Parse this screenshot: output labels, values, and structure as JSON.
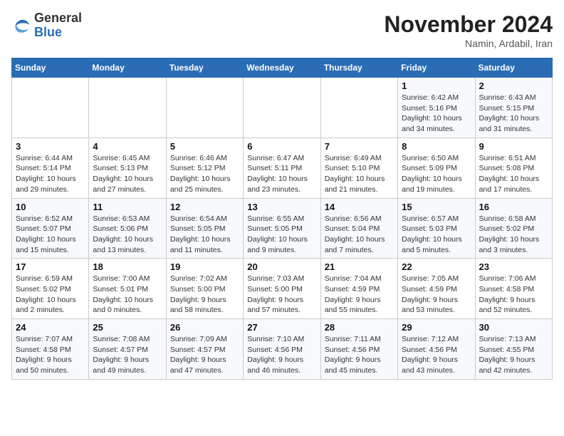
{
  "header": {
    "logo_line1": "General",
    "logo_line2": "Blue",
    "month": "November 2024",
    "location": "Namin, Ardabil, Iran"
  },
  "weekdays": [
    "Sunday",
    "Monday",
    "Tuesday",
    "Wednesday",
    "Thursday",
    "Friday",
    "Saturday"
  ],
  "weeks": [
    [
      {
        "day": "",
        "detail": ""
      },
      {
        "day": "",
        "detail": ""
      },
      {
        "day": "",
        "detail": ""
      },
      {
        "day": "",
        "detail": ""
      },
      {
        "day": "",
        "detail": ""
      },
      {
        "day": "1",
        "detail": "Sunrise: 6:42 AM\nSunset: 5:16 PM\nDaylight: 10 hours\nand 34 minutes."
      },
      {
        "day": "2",
        "detail": "Sunrise: 6:43 AM\nSunset: 5:15 PM\nDaylight: 10 hours\nand 31 minutes."
      }
    ],
    [
      {
        "day": "3",
        "detail": "Sunrise: 6:44 AM\nSunset: 5:14 PM\nDaylight: 10 hours\nand 29 minutes."
      },
      {
        "day": "4",
        "detail": "Sunrise: 6:45 AM\nSunset: 5:13 PM\nDaylight: 10 hours\nand 27 minutes."
      },
      {
        "day": "5",
        "detail": "Sunrise: 6:46 AM\nSunset: 5:12 PM\nDaylight: 10 hours\nand 25 minutes."
      },
      {
        "day": "6",
        "detail": "Sunrise: 6:47 AM\nSunset: 5:11 PM\nDaylight: 10 hours\nand 23 minutes."
      },
      {
        "day": "7",
        "detail": "Sunrise: 6:49 AM\nSunset: 5:10 PM\nDaylight: 10 hours\nand 21 minutes."
      },
      {
        "day": "8",
        "detail": "Sunrise: 6:50 AM\nSunset: 5:09 PM\nDaylight: 10 hours\nand 19 minutes."
      },
      {
        "day": "9",
        "detail": "Sunrise: 6:51 AM\nSunset: 5:08 PM\nDaylight: 10 hours\nand 17 minutes."
      }
    ],
    [
      {
        "day": "10",
        "detail": "Sunrise: 6:52 AM\nSunset: 5:07 PM\nDaylight: 10 hours\nand 15 minutes."
      },
      {
        "day": "11",
        "detail": "Sunrise: 6:53 AM\nSunset: 5:06 PM\nDaylight: 10 hours\nand 13 minutes."
      },
      {
        "day": "12",
        "detail": "Sunrise: 6:54 AM\nSunset: 5:05 PM\nDaylight: 10 hours\nand 11 minutes."
      },
      {
        "day": "13",
        "detail": "Sunrise: 6:55 AM\nSunset: 5:05 PM\nDaylight: 10 hours\nand 9 minutes."
      },
      {
        "day": "14",
        "detail": "Sunrise: 6:56 AM\nSunset: 5:04 PM\nDaylight: 10 hours\nand 7 minutes."
      },
      {
        "day": "15",
        "detail": "Sunrise: 6:57 AM\nSunset: 5:03 PM\nDaylight: 10 hours\nand 5 minutes."
      },
      {
        "day": "16",
        "detail": "Sunrise: 6:58 AM\nSunset: 5:02 PM\nDaylight: 10 hours\nand 3 minutes."
      }
    ],
    [
      {
        "day": "17",
        "detail": "Sunrise: 6:59 AM\nSunset: 5:02 PM\nDaylight: 10 hours\nand 2 minutes."
      },
      {
        "day": "18",
        "detail": "Sunrise: 7:00 AM\nSunset: 5:01 PM\nDaylight: 10 hours\nand 0 minutes."
      },
      {
        "day": "19",
        "detail": "Sunrise: 7:02 AM\nSunset: 5:00 PM\nDaylight: 9 hours\nand 58 minutes."
      },
      {
        "day": "20",
        "detail": "Sunrise: 7:03 AM\nSunset: 5:00 PM\nDaylight: 9 hours\nand 57 minutes."
      },
      {
        "day": "21",
        "detail": "Sunrise: 7:04 AM\nSunset: 4:59 PM\nDaylight: 9 hours\nand 55 minutes."
      },
      {
        "day": "22",
        "detail": "Sunrise: 7:05 AM\nSunset: 4:59 PM\nDaylight: 9 hours\nand 53 minutes."
      },
      {
        "day": "23",
        "detail": "Sunrise: 7:06 AM\nSunset: 4:58 PM\nDaylight: 9 hours\nand 52 minutes."
      }
    ],
    [
      {
        "day": "24",
        "detail": "Sunrise: 7:07 AM\nSunset: 4:58 PM\nDaylight: 9 hours\nand 50 minutes."
      },
      {
        "day": "25",
        "detail": "Sunrise: 7:08 AM\nSunset: 4:57 PM\nDaylight: 9 hours\nand 49 minutes."
      },
      {
        "day": "26",
        "detail": "Sunrise: 7:09 AM\nSunset: 4:57 PM\nDaylight: 9 hours\nand 47 minutes."
      },
      {
        "day": "27",
        "detail": "Sunrise: 7:10 AM\nSunset: 4:56 PM\nDaylight: 9 hours\nand 46 minutes."
      },
      {
        "day": "28",
        "detail": "Sunrise: 7:11 AM\nSunset: 4:56 PM\nDaylight: 9 hours\nand 45 minutes."
      },
      {
        "day": "29",
        "detail": "Sunrise: 7:12 AM\nSunset: 4:56 PM\nDaylight: 9 hours\nand 43 minutes."
      },
      {
        "day": "30",
        "detail": "Sunrise: 7:13 AM\nSunset: 4:55 PM\nDaylight: 9 hours\nand 42 minutes."
      }
    ]
  ]
}
